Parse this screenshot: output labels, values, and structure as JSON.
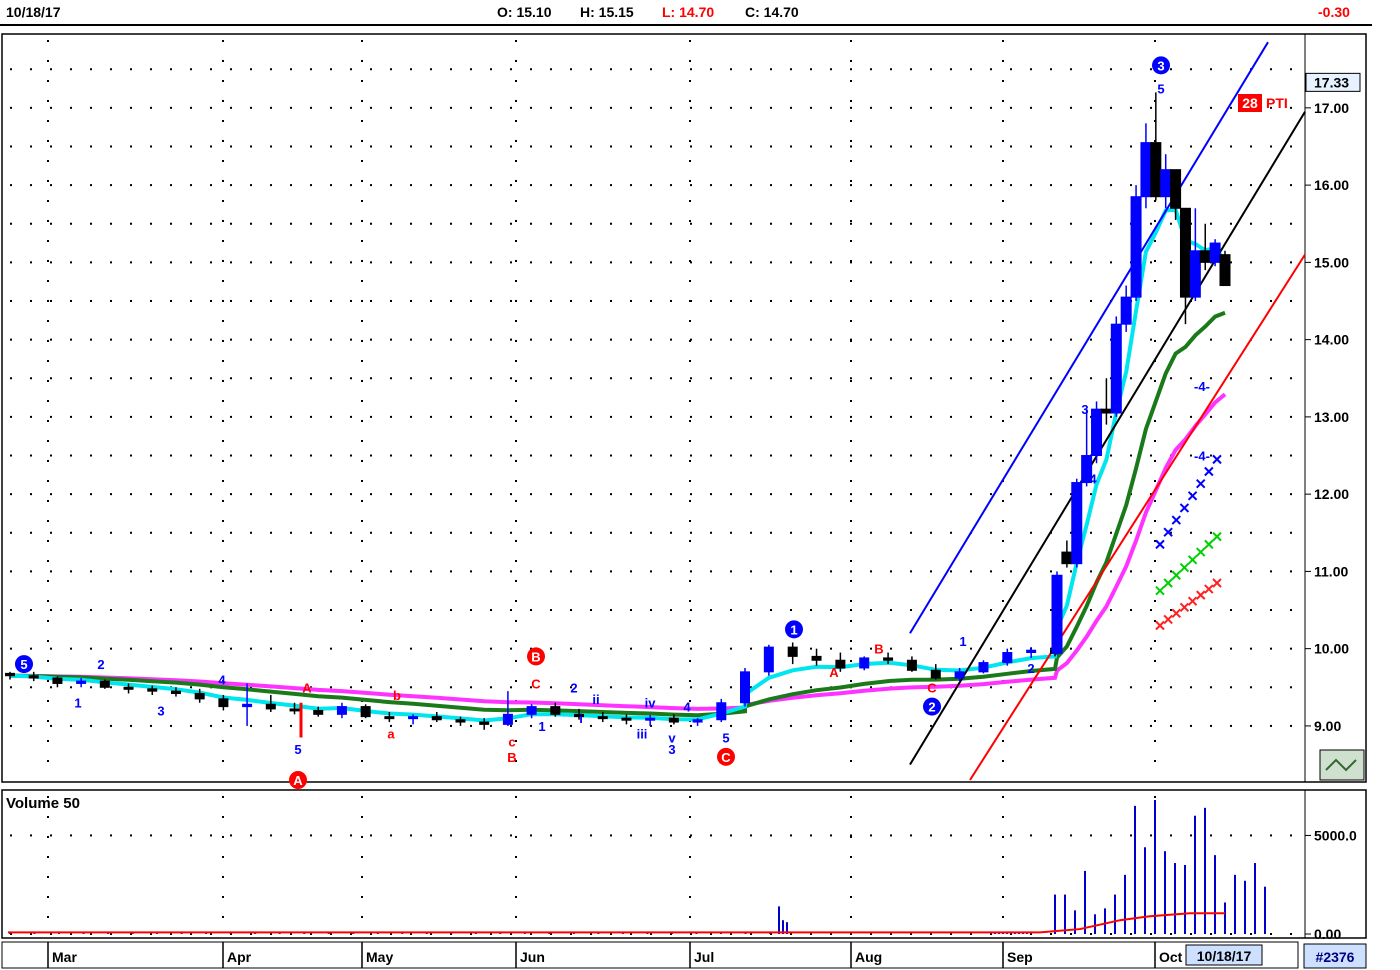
{
  "header": {
    "date": "10/18/17",
    "open": "O: 15.10",
    "high": "H: 15.15",
    "low": "L: 14.70",
    "close": "C: 14.70",
    "change": "-0.30"
  },
  "footer": {
    "current_date": "10/18/17",
    "chart_id": "#2376"
  },
  "colors": {
    "up_candle": "#0000ff",
    "down_candle": "#000000",
    "cyan_ma": "#00e5ee",
    "green_ma": "#1a7a1a",
    "magenta_ma": "#ff33ff",
    "red_line": "#ff0000",
    "blue_channel": "#0000ff",
    "volume_avg": "#ff0000",
    "pti_badge": "#ff0000"
  },
  "price_panel": {
    "last_price_tag": "17.33",
    "pti_value": "28",
    "pti_label": "PTI",
    "wave_labels": [
      {
        "text": "5",
        "color": "#0000ff",
        "circled": true,
        "x_month": "Mar",
        "y": 9.8
      },
      {
        "text": "1",
        "color": "#0000ff",
        "y": 9.3
      },
      {
        "text": "2",
        "color": "#0000ff",
        "y": 9.8
      },
      {
        "text": "3",
        "color": "#0000ff",
        "y": 9.2
      },
      {
        "text": "4",
        "color": "#0000ff",
        "y": 9.6
      },
      {
        "text": "A",
        "color": "#ff0000",
        "y": 9.5
      },
      {
        "text": "5",
        "color": "#0000ff",
        "y": 8.7
      },
      {
        "text": "A",
        "color": "#ff0000",
        "circled": true,
        "y": 8.3
      },
      {
        "text": "b",
        "color": "#ff0000",
        "y": 9.4
      },
      {
        "text": "a",
        "color": "#ff0000",
        "y": 8.9
      },
      {
        "text": "c",
        "color": "#ff0000",
        "y": 8.8
      },
      {
        "text": "B",
        "color": "#ff0000",
        "y": 8.6
      },
      {
        "text": "B",
        "color": "#ff0000",
        "circled": true,
        "y": 9.9
      },
      {
        "text": "C",
        "color": "#ff0000",
        "y": 9.55
      },
      {
        "text": "1",
        "color": "#0000ff",
        "y": 9.0
      },
      {
        "text": "2",
        "color": "#0000ff",
        "y": 9.5
      },
      {
        "text": "i",
        "color": "#0000ff",
        "y": 9.1
      },
      {
        "text": "ii",
        "color": "#0000ff",
        "y": 9.35
      },
      {
        "text": "iii",
        "color": "#0000ff",
        "y": 8.9
      },
      {
        "text": "iv",
        "color": "#0000ff",
        "y": 9.3
      },
      {
        "text": "v",
        "color": "#0000ff",
        "y": 8.85
      },
      {
        "text": "3",
        "color": "#0000ff",
        "y": 8.7
      },
      {
        "text": "4",
        "color": "#0000ff",
        "y": 9.25
      },
      {
        "text": "5",
        "color": "#0000ff",
        "y": 8.85
      },
      {
        "text": "C",
        "color": "#ff0000",
        "circled": true,
        "y": 8.6
      },
      {
        "text": "1",
        "color": "#0000ff",
        "circled": true,
        "y": 10.25
      },
      {
        "text": "A",
        "color": "#ff0000",
        "y": 9.7
      },
      {
        "text": "B",
        "color": "#ff0000",
        "y": 10.0
      },
      {
        "text": "C",
        "color": "#ff0000",
        "y": 9.5
      },
      {
        "text": "2",
        "color": "#0000ff",
        "circled": true,
        "y": 9.25
      },
      {
        "text": "1",
        "color": "#0000ff",
        "y": 10.1
      },
      {
        "text": "2",
        "color": "#0000ff",
        "y": 9.75
      },
      {
        "text": "3",
        "color": "#0000ff",
        "y": 13.1
      },
      {
        "text": "4",
        "color": "#0000ff",
        "y": 12.2
      },
      {
        "text": "3",
        "color": "#0000ff",
        "circled": true,
        "y": 17.55
      },
      {
        "text": "5",
        "color": "#0000ff",
        "y": 17.25
      },
      {
        "text": "-4-",
        "color": "#0000ff",
        "y": 13.4
      },
      {
        "text": "-4-",
        "color": "#0000ff",
        "y": 12.5
      }
    ]
  },
  "volume_panel": {
    "label": "Volume 50"
  },
  "chart_data": {
    "type": "candlestick",
    "title": "",
    "x_tick_labels": [
      "Mar",
      "Apr",
      "May",
      "Jun",
      "Jul",
      "Aug",
      "Sep",
      "Oct"
    ],
    "y_tick_labels": [
      "9.00",
      "10.00",
      "11.00",
      "12.00",
      "13.00",
      "14.00",
      "15.00",
      "16.00",
      "17.00"
    ],
    "ylim": [
      8.3,
      17.93
    ],
    "volume_tick_labels": [
      "0.00",
      "5000.0"
    ],
    "volume_ylim": [
      0,
      7000
    ],
    "grid": true,
    "series": [
      {
        "name": "price",
        "ohlc": [
          [
            9.68,
            9.7,
            9.6,
            9.65
          ],
          [
            9.65,
            9.7,
            9.58,
            9.62
          ],
          [
            9.62,
            9.64,
            9.5,
            9.55
          ],
          [
            9.55,
            9.62,
            9.5,
            9.58
          ],
          [
            9.58,
            9.6,
            9.48,
            9.5
          ],
          [
            9.5,
            9.55,
            9.42,
            9.48
          ],
          [
            9.48,
            9.52,
            9.4,
            9.45
          ],
          [
            9.45,
            9.5,
            9.38,
            9.42
          ],
          [
            9.42,
            9.48,
            9.3,
            9.35
          ],
          [
            9.35,
            9.4,
            9.2,
            9.25
          ],
          [
            9.25,
            9.55,
            9.0,
            9.28
          ],
          [
            9.28,
            9.4,
            9.18,
            9.22
          ],
          [
            9.22,
            9.3,
            9.15,
            9.2
          ],
          [
            9.2,
            9.25,
            9.12,
            9.15
          ],
          [
            9.15,
            9.3,
            9.1,
            9.25
          ],
          [
            9.25,
            9.28,
            9.1,
            9.12
          ],
          [
            9.12,
            9.18,
            9.05,
            9.1
          ],
          [
            9.1,
            9.15,
            9.02,
            9.12
          ],
          [
            9.12,
            9.18,
            9.05,
            9.08
          ],
          [
            9.08,
            9.12,
            9.0,
            9.05
          ],
          [
            9.05,
            9.1,
            8.95,
            9.02
          ],
          [
            9.02,
            9.45,
            9.0,
            9.15
          ],
          [
            9.15,
            9.28,
            9.1,
            9.25
          ],
          [
            9.25,
            9.3,
            9.12,
            9.15
          ],
          [
            9.15,
            9.22,
            9.08,
            9.12
          ],
          [
            9.12,
            9.18,
            9.05,
            9.1
          ],
          [
            9.1,
            9.15,
            9.02,
            9.08
          ],
          [
            9.08,
            9.14,
            9.0,
            9.1
          ],
          [
            9.1,
            9.15,
            9.02,
            9.05
          ],
          [
            9.05,
            9.1,
            9.0,
            9.08
          ],
          [
            9.08,
            9.35,
            9.05,
            9.3
          ],
          [
            9.3,
            9.45,
            9.25,
            9.42
          ],
          [
            9.42,
            9.75,
            9.4,
            9.7
          ],
          [
            9.7,
            10.05,
            9.65,
            10.02
          ],
          [
            10.02,
            10.08,
            9.8,
            9.9
          ],
          [
            9.9,
            10.0,
            9.78,
            9.85
          ],
          [
            9.85,
            9.95,
            9.7,
            9.75
          ],
          [
            9.75,
            9.9,
            9.72,
            9.88
          ],
          [
            9.88,
            9.95,
            9.8,
            9.85
          ],
          [
            9.85,
            9.9,
            9.7,
            9.72
          ],
          [
            9.72,
            9.8,
            9.6,
            9.62
          ],
          [
            9.62,
            9.75,
            9.58,
            9.7
          ],
          [
            9.7,
            9.85,
            9.68,
            9.82
          ],
          [
            9.82,
            10.0,
            9.78,
            9.95
          ],
          [
            9.95,
            10.02,
            9.88,
            9.98
          ],
          [
            9.98,
            10.0,
            9.9,
            9.94
          ],
          [
            9.94,
            11.0,
            9.92,
            10.95
          ],
          [
            11.25,
            11.4,
            11.05,
            11.1
          ],
          [
            11.1,
            12.2,
            11.05,
            12.15
          ],
          [
            12.15,
            13.1,
            12.1,
            12.5
          ],
          [
            12.5,
            13.2,
            12.4,
            13.1
          ],
          [
            13.1,
            13.5,
            12.9,
            13.05
          ],
          [
            13.05,
            14.3,
            13.0,
            14.2
          ],
          [
            14.2,
            14.7,
            14.1,
            14.55
          ],
          [
            14.55,
            16.0,
            14.5,
            15.85
          ],
          [
            15.85,
            16.8,
            15.7,
            16.55
          ],
          [
            16.55,
            17.2,
            15.8,
            15.85
          ],
          [
            15.85,
            16.4,
            15.7,
            16.2
          ],
          [
            16.2,
            16.1,
            15.55,
            15.7
          ],
          [
            15.7,
            15.1,
            14.2,
            14.55
          ],
          [
            14.55,
            15.7,
            14.5,
            15.15
          ],
          [
            15.15,
            15.5,
            14.9,
            15.0
          ],
          [
            15.0,
            15.3,
            14.95,
            15.25
          ],
          [
            15.1,
            15.15,
            14.7,
            14.7
          ]
        ]
      },
      {
        "name": "volume",
        "values": [
          40,
          40,
          40,
          40,
          40,
          40,
          40,
          40,
          40,
          40,
          40,
          40,
          40,
          40,
          40,
          40,
          40,
          40,
          40,
          40,
          40,
          40,
          40,
          40,
          40,
          40,
          40,
          40,
          40,
          40,
          40,
          40,
          1400,
          700,
          600,
          40,
          40,
          40,
          40,
          40,
          40,
          40,
          40,
          40,
          40,
          40,
          2000,
          2000,
          1200,
          3200,
          1000,
          1300,
          2000,
          3000,
          1500,
          6500,
          4400,
          6800,
          4200,
          3600,
          3500,
          6000,
          6400,
          4000,
          1600,
          3000,
          2700,
          3600,
          2400
        ]
      }
    ]
  }
}
